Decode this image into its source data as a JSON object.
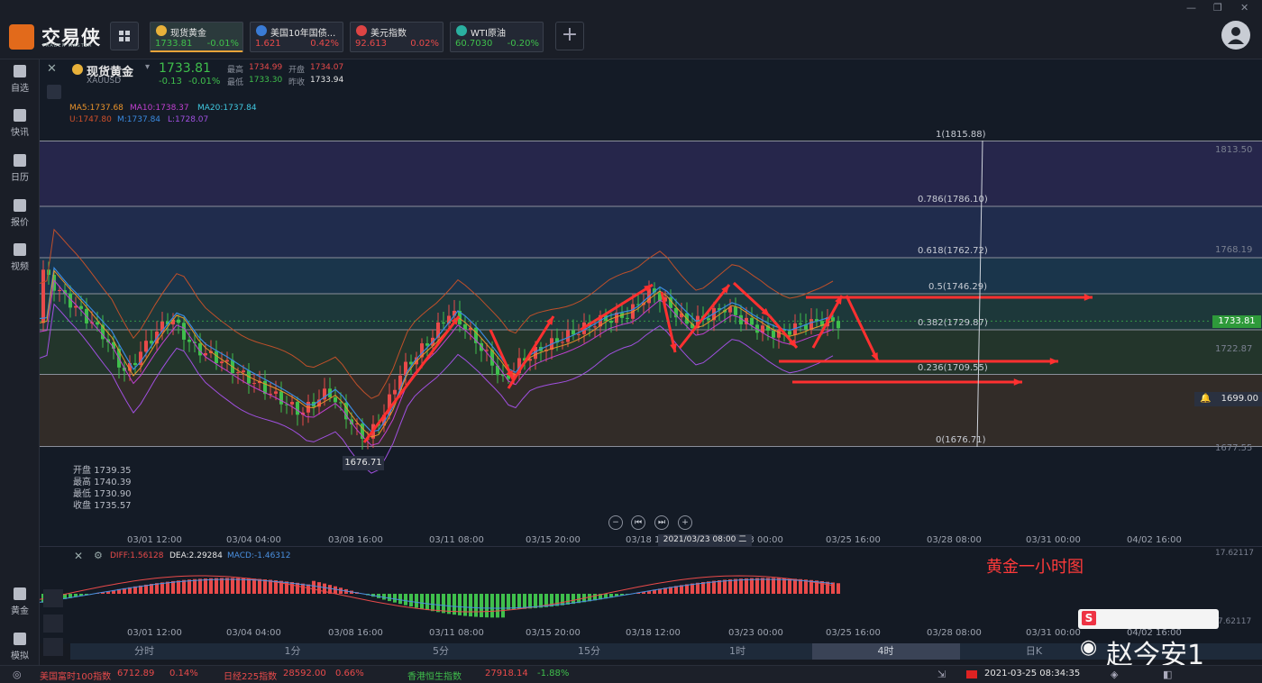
{
  "app": {
    "name": "交易侠",
    "subtitle": "TRADER MASTER",
    "add_tab": "+"
  },
  "tabs": [
    {
      "name": "现货黄金",
      "price": "1733.81",
      "change": "-0.01%",
      "color": "#3fbf4c",
      "icon_color": "#e8b13a",
      "active": true
    },
    {
      "name": "美国10年国债...",
      "price": "1.621",
      "change": "0.42%",
      "color": "#e84a4a",
      "icon_color": "#3a7bd5",
      "active": false
    },
    {
      "name": "美元指数",
      "price": "92.613",
      "change": "0.02%",
      "color": "#e84a4a",
      "icon_color": "#d44",
      "active": false
    },
    {
      "name": "WTI原油",
      "price": "60.7030",
      "change": "-0.20%",
      "color": "#3fbf4c",
      "icon_color": "#2ab0a0",
      "active": false
    }
  ],
  "sidebar": [
    {
      "label": "自选",
      "icon": "star-icon"
    },
    {
      "label": "快讯",
      "icon": "news-icon"
    },
    {
      "label": "日历",
      "icon": "calendar-icon"
    },
    {
      "label": "报价",
      "icon": "quote-icon"
    },
    {
      "label": "视频",
      "icon": "video-icon"
    },
    {
      "label": "黄金",
      "icon": "gold-icon"
    },
    {
      "label": "模拟",
      "icon": "simulate-icon"
    }
  ],
  "instrument": {
    "name": "现货黄金",
    "symbol": "XAUUSD",
    "price": "1733.81",
    "change": "-0.13",
    "change_pct": "-0.01%",
    "high_label": "最高",
    "high": "1734.99",
    "open_label": "开盘",
    "open": "1734.07",
    "low_label": "最低",
    "low": "1733.30",
    "prev_label": "昨收",
    "prev": "1733.94"
  },
  "indicators": {
    "ma5": "MA5:1737.68",
    "ma10": "MA10:1738.37",
    "ma20": "MA20:1737.84",
    "boll_u": "U:1747.80",
    "boll_m": "M:1737.84",
    "boll_l": "L:1728.07"
  },
  "fib_levels": [
    {
      "label": "1(1815.88)"
    },
    {
      "label": "0.786(1786.10)"
    },
    {
      "label": "0.618(1762.72)"
    },
    {
      "label": "0.5(1746.29)"
    },
    {
      "label": "0.382(1729.87)"
    },
    {
      "label": "0.236(1709.55)"
    },
    {
      "label": "0(1676.71)"
    }
  ],
  "right_axis": [
    "1813.50",
    "1768.19",
    "1722.87",
    "1677.55"
  ],
  "price_tag": "1733.81",
  "alert_tag": "1699.00",
  "low_tag": "1676.71",
  "ohlc_box": [
    {
      "label": "开盘",
      "value": "1739.35"
    },
    {
      "label": "最高",
      "value": "1740.39"
    },
    {
      "label": "最低",
      "value": "1730.90"
    },
    {
      "label": "收盘",
      "value": "1735.57"
    }
  ],
  "x_axis": [
    "03/01 12:00",
    "03/04 04:00",
    "03/08 16:00",
    "03/11 08:00",
    "03/15 20:00",
    "03/18 12:00",
    "03/23 00:00",
    "03/25 16:00",
    "03/28 08:00",
    "03/31 00:00",
    "04/02 16:00"
  ],
  "crosshair_date": "2021/03/23 08:00 二",
  "macd_x_axis": [
    "03/01 12:00",
    "03/04 04:00",
    "03/08 16:00",
    "03/11 08:00",
    "03/15 20:00",
    "03/18 12:00",
    "03/23 00:00",
    "03/25 16:00",
    "03/28 08:00",
    "03/31 00:00",
    "04/02 16:00"
  ],
  "macd": {
    "diff": "DIFF:1.56128",
    "dea": "DEA:2.29284",
    "macd": "MACD:-1.46312",
    "axis_top": "17.62117",
    "axis_bottom": "-17.62117"
  },
  "annotation": "黄金一小时图",
  "periods": [
    "分时",
    "1分",
    "5分",
    "15分",
    "1时",
    "4时",
    "日K"
  ],
  "selected_period": "4时",
  "watermark": "赵今安1",
  "ticker": [
    {
      "name": "美国富时100指数",
      "value": "6712.89",
      "change": "0.14%",
      "dir": "up"
    },
    {
      "name": "日经225指数",
      "value": "28592.00",
      "change": "0.66%",
      "dir": "up"
    },
    {
      "name": "香港恒生指数",
      "value": "27918.14",
      "change": "-1.88%",
      "dir": "dn"
    }
  ],
  "datetime": "2021-03-25 08:34:35"
}
